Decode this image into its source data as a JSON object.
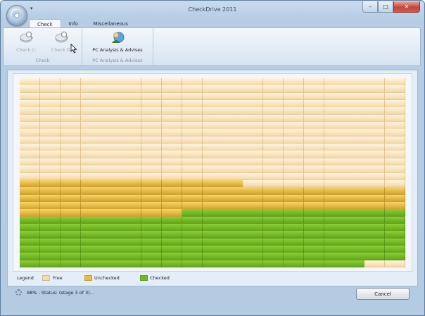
{
  "window": {
    "title": "CheckDrive 2011",
    "qat_arrow": "▾",
    "controls": {
      "minimize": "–",
      "maximize": "□",
      "close": "✕"
    }
  },
  "ribbon": {
    "tabs": [
      "Check",
      "Info",
      "Miscellaneous"
    ],
    "active_tab": "Check",
    "groups": [
      {
        "label": "Check",
        "buttons": [
          {
            "label": "Check C:",
            "enabled": false
          },
          {
            "label": "Check D:",
            "enabled": false
          }
        ]
      },
      {
        "label": "PC Analysis & Advises",
        "buttons": [
          {
            "label": "PC Analysis & Advises",
            "enabled": true
          }
        ]
      }
    ]
  },
  "map": {
    "columns": 19,
    "rows": 26,
    "segments": [
      {
        "state": "free",
        "cells": 266
      },
      {
        "state": "unchecked",
        "cells": 11
      },
      {
        "state": "free",
        "cells": 8
      },
      {
        "state": "unchecked",
        "cells": 65
      },
      {
        "state": "checked",
        "cells": 142
      },
      {
        "state": "free",
        "cells": 8
      },
      {
        "state": "checked",
        "cells": 132
      }
    ]
  },
  "legend": {
    "title": "Legend",
    "items": [
      {
        "key": "free",
        "label": "Free",
        "color": "#f7dcaa"
      },
      {
        "key": "unchecked",
        "label": "Unchecked",
        "color": "#e6bb3f"
      },
      {
        "key": "checked",
        "label": "Checked",
        "color": "#74b82a"
      }
    ]
  },
  "status": {
    "text": "98% - Status: (stage 3 of 3)...",
    "progress_percent": 98,
    "stage": 3,
    "stage_total": 3
  },
  "cancel_label": "Cancel"
}
